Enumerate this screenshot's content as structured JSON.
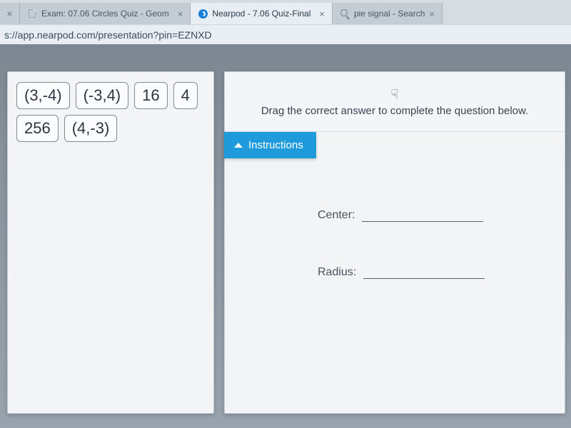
{
  "browser": {
    "tabs": [
      {
        "title": "Exam: 07.06 Circles Quiz - Geom",
        "icon": "page"
      },
      {
        "title": "Nearpod - 7.06 Quiz-Final",
        "icon": "nearpod"
      },
      {
        "title": "pie signal - Search",
        "icon": "search"
      }
    ],
    "url_fragment": "s://app.nearpod.com/presentation?pin=EZNXD"
  },
  "quiz": {
    "answer_tiles": [
      "(3,-4)",
      "(-3,4)",
      "16",
      "4",
      "256",
      "(4,-3)"
    ],
    "prompt": "Drag the correct answer to complete the question below.",
    "instructions_label": "Instructions",
    "fields": {
      "center_label": "Center:",
      "radius_label": "Radius:"
    }
  },
  "icons": {
    "hand_cursor": "☟",
    "close": "×"
  }
}
